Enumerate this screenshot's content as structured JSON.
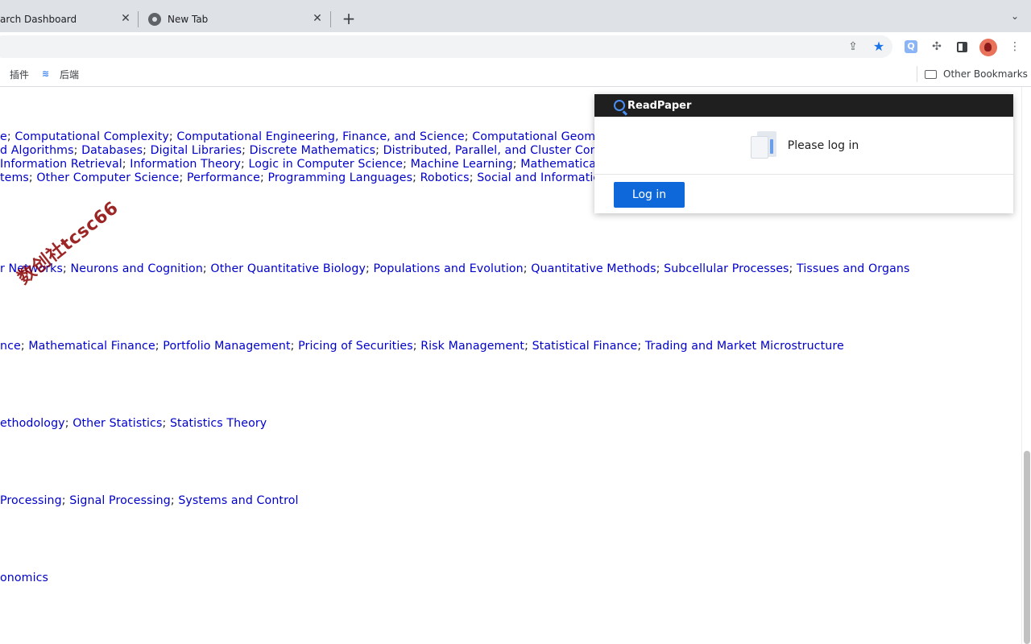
{
  "tabs": [
    {
      "title": "arch Dashboard | S",
      "close": "✕"
    },
    {
      "title": "New Tab",
      "close": "✕"
    }
  ],
  "new_tab_label": "+",
  "tab_list_label": "⌄",
  "bookmarks": {
    "items": [
      {
        "label": "插件"
      },
      {
        "label": "后端"
      }
    ],
    "other": "Other Bookmarks"
  },
  "content": {
    "lines": [
      {
        "segments": [
          "e",
          "Computational Complexity",
          "Computational Engineering, Finance, and Science",
          "Computational Geometry"
        ]
      },
      {
        "segments": [
          "d Algorithms",
          "Databases",
          "Digital Libraries",
          "Discrete Mathematics",
          "Distributed, Parallel, and Cluster Compu"
        ]
      },
      {
        "segments": [
          "Information Retrieval",
          "Information Theory",
          "Logic in Computer Science",
          "Machine Learning",
          "Mathematical So"
        ]
      },
      {
        "segments": [
          "tems",
          "Other Computer Science",
          "Performance",
          "Programming Languages",
          "Robotics",
          "Social and Information N"
        ]
      },
      {
        "segments": [
          "r Networks",
          "Neurons and Cognition",
          "Other Quantitative Biology",
          "Populations and Evolution",
          "Quantitative Methods",
          "Subcellular Processes",
          "Tissues and Organs"
        ]
      },
      {
        "segments": [
          "nce",
          "Mathematical Finance",
          "Portfolio Management",
          "Pricing of Securities",
          "Risk Management",
          "Statistical Finance",
          "Trading and Market Microstructure"
        ]
      },
      {
        "segments": [
          "ethodology",
          "Other Statistics",
          "Statistics Theory"
        ]
      },
      {
        "segments": [
          "Processing",
          "Signal Processing",
          "Systems and Control"
        ]
      },
      {
        "segments": [
          "onomics"
        ]
      }
    ],
    "separator": "; "
  },
  "watermark": "数创社tcsc66",
  "popup": {
    "title": "ReadPaper",
    "message": "Please log in",
    "login_button": "Log in"
  },
  "colors": {
    "link": "#0000cc",
    "login_button": "#0f68d9",
    "popup_header": "#1f1f1f"
  }
}
